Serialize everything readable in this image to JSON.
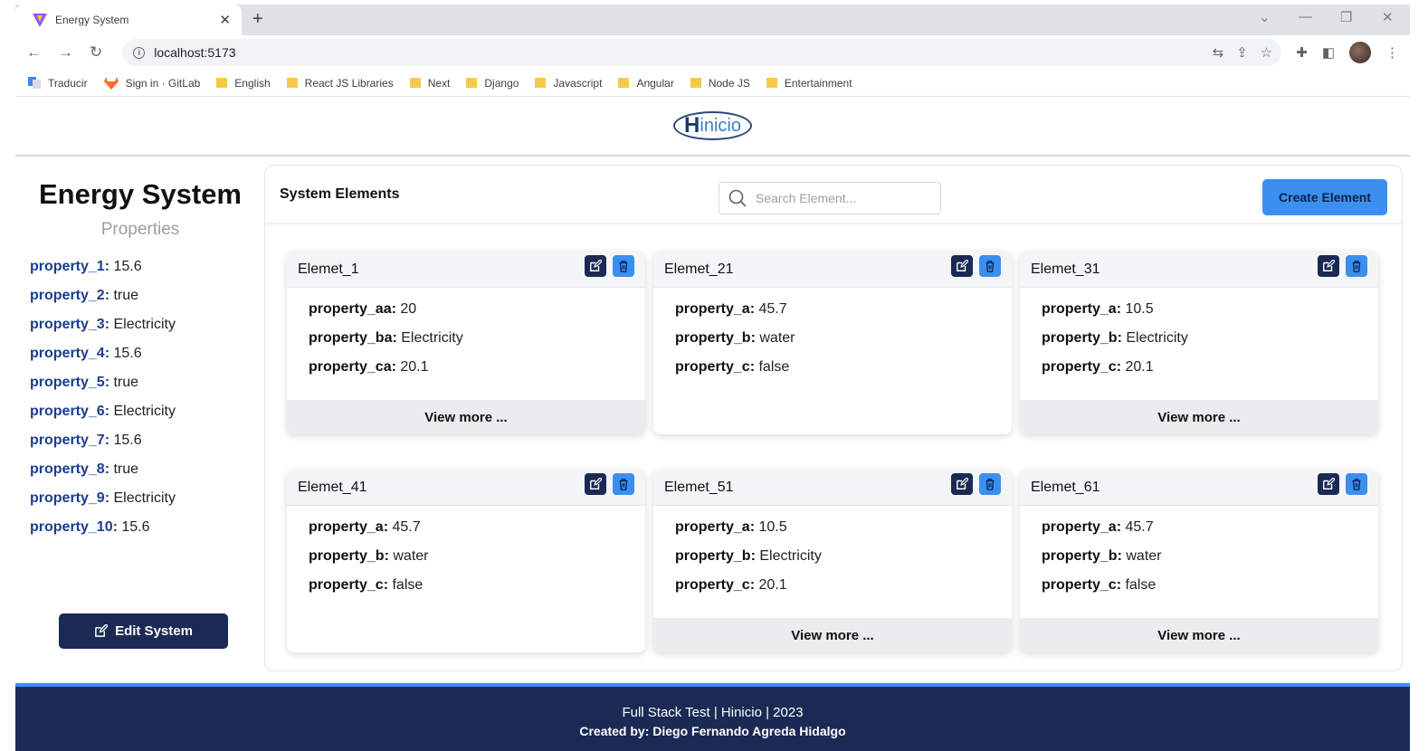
{
  "browser": {
    "tab_title": "Energy System",
    "url": "localhost:5173",
    "bookmarks": [
      {
        "label": "Traducir",
        "type": "translate"
      },
      {
        "label": "Sign in · GitLab",
        "type": "gitlab"
      },
      {
        "label": "English",
        "type": "folder"
      },
      {
        "label": "React JS Libraries",
        "type": "folder"
      },
      {
        "label": "Next",
        "type": "folder"
      },
      {
        "label": "Django",
        "type": "folder"
      },
      {
        "label": "Javascript",
        "type": "folder"
      },
      {
        "label": "Angular",
        "type": "folder"
      },
      {
        "label": "Node JS",
        "type": "folder"
      },
      {
        "label": "Entertainment",
        "type": "folder"
      }
    ]
  },
  "logo": {
    "big": "H",
    "rest": "inicio"
  },
  "sidebar": {
    "title": "Energy System",
    "subtitle": "Properties",
    "properties": [
      {
        "key": "property_1:",
        "value": "15.6"
      },
      {
        "key": "property_2:",
        "value": "true"
      },
      {
        "key": "property_3:",
        "value": "Electricity"
      },
      {
        "key": "property_4:",
        "value": "15.6"
      },
      {
        "key": "property_5:",
        "value": "true"
      },
      {
        "key": "property_6:",
        "value": "Electricity"
      },
      {
        "key": "property_7:",
        "value": "15.6"
      },
      {
        "key": "property_8:",
        "value": "true"
      },
      {
        "key": "property_9:",
        "value": "Electricity"
      },
      {
        "key": "property_10:",
        "value": "15.6"
      }
    ],
    "edit_label": "Edit System"
  },
  "panel": {
    "title": "System Elements",
    "search_placeholder": "Search Element...",
    "create_label": "Create Element",
    "view_more_label": "View more ...",
    "elements": [
      {
        "name": "Elemet_1",
        "view_more": true,
        "props": [
          {
            "key": "property_aa:",
            "value": "20"
          },
          {
            "key": "property_ba:",
            "value": "Electricity"
          },
          {
            "key": "property_ca:",
            "value": "20.1"
          }
        ]
      },
      {
        "name": "Elemet_21",
        "view_more": false,
        "props": [
          {
            "key": "property_a:",
            "value": "45.7"
          },
          {
            "key": "property_b:",
            "value": "water"
          },
          {
            "key": "property_c:",
            "value": "false"
          }
        ]
      },
      {
        "name": "Elemet_31",
        "view_more": true,
        "props": [
          {
            "key": "property_a:",
            "value": "10.5"
          },
          {
            "key": "property_b:",
            "value": "Electricity"
          },
          {
            "key": "property_c:",
            "value": "20.1"
          }
        ]
      },
      {
        "name": "Elemet_41",
        "view_more": false,
        "props": [
          {
            "key": "property_a:",
            "value": "45.7"
          },
          {
            "key": "property_b:",
            "value": "water"
          },
          {
            "key": "property_c:",
            "value": "false"
          }
        ]
      },
      {
        "name": "Elemet_51",
        "view_more": true,
        "props": [
          {
            "key": "property_a:",
            "value": "10.5"
          },
          {
            "key": "property_b:",
            "value": "Electricity"
          },
          {
            "key": "property_c:",
            "value": "20.1"
          }
        ]
      },
      {
        "name": "Elemet_61",
        "view_more": true,
        "props": [
          {
            "key": "property_a:",
            "value": "45.7"
          },
          {
            "key": "property_b:",
            "value": "water"
          },
          {
            "key": "property_c:",
            "value": "false"
          }
        ]
      }
    ]
  },
  "footer": {
    "line1": "Full Stack Test | Hinicio | 2023",
    "line2": "Created by: Diego Fernando Agreda Hidalgo"
  },
  "colors": {
    "navy": "#1b2a55",
    "accent": "#3b8ff0",
    "prop_key": "#1a3d8f"
  }
}
